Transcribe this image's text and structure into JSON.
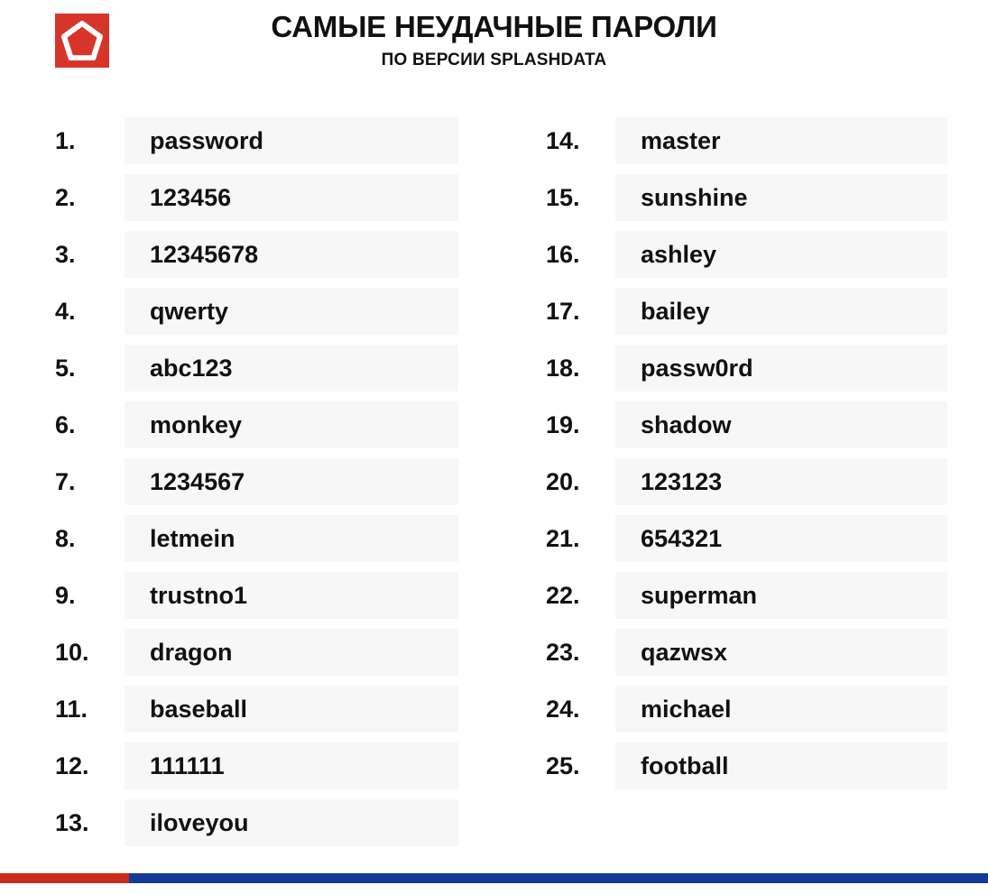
{
  "header": {
    "title": "САМЫЕ НЕУДАЧНЫЕ ПАРОЛИ",
    "subtitle": "ПО ВЕРСИИ SPLASHDATA",
    "logo_icon": "pentagon-logo-icon"
  },
  "colors": {
    "logo_red": "#d8352a",
    "stripe_blue": "#123d9c",
    "stripe_red": "#cc2a18",
    "row_band": "#f7f7f8",
    "text": "#111111"
  },
  "list": {
    "left": [
      {
        "rank": "1.",
        "password": "password"
      },
      {
        "rank": "2.",
        "password": "123456"
      },
      {
        "rank": "3.",
        "password": "12345678"
      },
      {
        "rank": "4.",
        "password": "qwerty"
      },
      {
        "rank": "5.",
        "password": "abc123"
      },
      {
        "rank": "6.",
        "password": "monkey"
      },
      {
        "rank": "7.",
        "password": "1234567"
      },
      {
        "rank": "8.",
        "password": "letmein"
      },
      {
        "rank": "9.",
        "password": "trustno1"
      },
      {
        "rank": "10.",
        "password": "dragon"
      },
      {
        "rank": "11.",
        "password": "baseball"
      },
      {
        "rank": "12.",
        "password": "111111"
      },
      {
        "rank": "13.",
        "password": "iloveyou"
      }
    ],
    "right": [
      {
        "rank": "14.",
        "password": "master"
      },
      {
        "rank": "15.",
        "password": "sunshine"
      },
      {
        "rank": "16.",
        "password": "ashley"
      },
      {
        "rank": "17.",
        "password": "bailey"
      },
      {
        "rank": "18.",
        "password": "passw0rd"
      },
      {
        "rank": "19.",
        "password": "shadow"
      },
      {
        "rank": "20.",
        "password": "123123"
      },
      {
        "rank": "21.",
        "password": "654321"
      },
      {
        "rank": "22.",
        "password": "superman"
      },
      {
        "rank": "23.",
        "password": "qazwsx"
      },
      {
        "rank": "24.",
        "password": "michael"
      },
      {
        "rank": "25.",
        "password": "football"
      }
    ]
  }
}
